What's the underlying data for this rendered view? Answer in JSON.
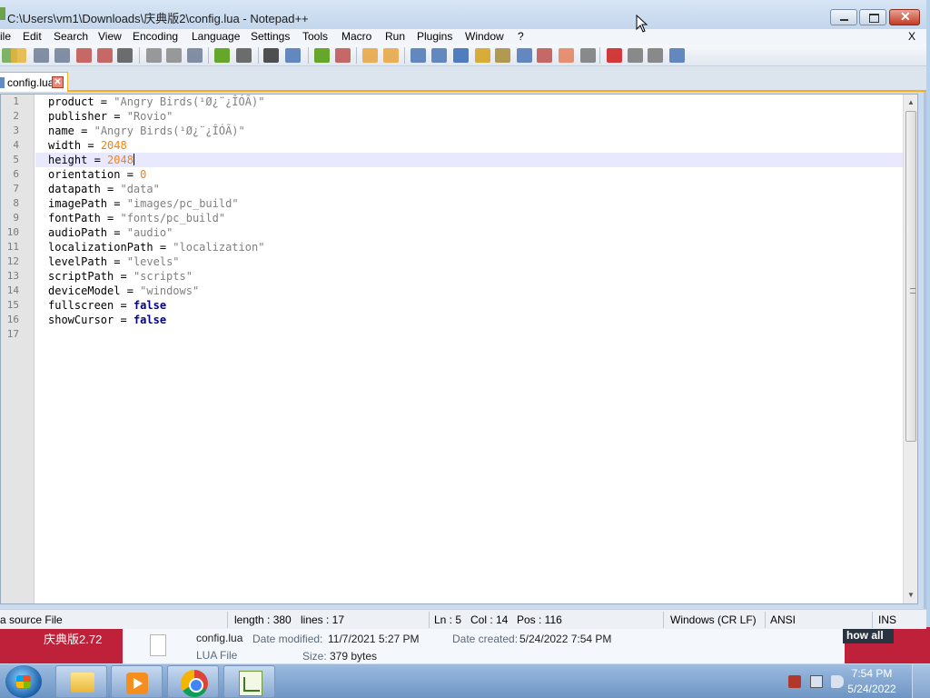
{
  "window": {
    "title": "C:\\Users\\vm1\\Downloads\\庆典版2\\config.lua - Notepad++"
  },
  "menu": {
    "items": [
      "ile",
      "Edit",
      "Search",
      "View",
      "Encoding",
      "Language",
      "Settings",
      "Tools",
      "Macro",
      "Run",
      "Plugins",
      "Window",
      "?"
    ],
    "close": "X"
  },
  "toolbar": {
    "icons": [
      "new-file-icon",
      "open-file-icon",
      "save-icon",
      "save-all-icon",
      "close-icon",
      "close-all-icon",
      "print-icon",
      "cut-icon",
      "copy-icon",
      "paste-icon",
      "undo-icon",
      "redo-icon",
      "find-icon",
      "replace-icon",
      "zoom-in-icon",
      "zoom-out-icon",
      "sync-vertical-icon",
      "sync-horizontal-icon",
      "word-wrap-icon",
      "show-all-chars-icon",
      "indent-guide-icon",
      "user-language-icon",
      "doc-map-icon",
      "function-list-icon",
      "folder-as-workspace-icon",
      "monitoring-icon",
      "record-macro-icon",
      "stop-record-icon",
      "play-macro-icon",
      "run-macro-multiple-icon",
      "save-macro-icon"
    ]
  },
  "tab": {
    "label": "config.lua",
    "close": "✕"
  },
  "editor": {
    "line_numbers": [
      "1",
      "2",
      "3",
      "4",
      "5",
      "6",
      "7",
      "8",
      "9",
      "10",
      "11",
      "12",
      "13",
      "14",
      "15",
      "16",
      "17"
    ],
    "lines": [
      {
        "key": "product",
        "eq": " = ",
        "value": "\"Angry Birds(¹Ø¿¨¿ÎÓÃ)\"",
        "kind": "str"
      },
      {
        "key": "publisher",
        "eq": " = ",
        "value": "\"Rovio\"",
        "kind": "str"
      },
      {
        "key": "name",
        "eq": " = ",
        "value": "\"Angry Birds(¹Ø¿¨¿ÎÓÃ)\"",
        "kind": "str"
      },
      {
        "key": "width",
        "eq": " = ",
        "value": "2048",
        "kind": "num"
      },
      {
        "key": "height",
        "eq": " = ",
        "value": "2048",
        "kind": "num"
      },
      {
        "key": "orientation",
        "eq": " = ",
        "value": "0",
        "kind": "num"
      },
      {
        "key": "datapath",
        "eq": " = ",
        "value": "\"data\"",
        "kind": "str"
      },
      {
        "key": "imagePath",
        "eq": " = ",
        "value": "\"images/pc_build\"",
        "kind": "str"
      },
      {
        "key": "fontPath",
        "eq": " = ",
        "value": "\"fonts/pc_build\"",
        "kind": "str"
      },
      {
        "key": "audioPath",
        "eq": " = ",
        "value": "\"audio\"",
        "kind": "str"
      },
      {
        "key": "localizationPath",
        "eq": " = ",
        "value": "\"localization\"",
        "kind": "str"
      },
      {
        "key": "levelPath",
        "eq": " = ",
        "value": "\"levels\"",
        "kind": "str"
      },
      {
        "key": "scriptPath",
        "eq": " = ",
        "value": "\"scripts\"",
        "kind": "str"
      },
      {
        "key": "deviceModel",
        "eq": " = ",
        "value": "\"windows\"",
        "kind": "str"
      },
      {
        "key": "fullscreen",
        "eq": " = ",
        "value": "false",
        "kind": "bool"
      },
      {
        "key": "showCursor",
        "eq": " = ",
        "value": "false",
        "kind": "bool"
      }
    ],
    "current_line": 5
  },
  "status": {
    "file_type": "a source File",
    "length": "length : 380",
    "lines": "lines : 17",
    "ln": "Ln : 5",
    "col": "Col : 14",
    "pos": "Pos : 116",
    "eol": "Windows (CR LF)",
    "encoding": "ANSI",
    "mode": "INS"
  },
  "explorer": {
    "left_text": "庆典版2.72",
    "show_all": "how all",
    "file_name": "config.lua",
    "file_type": "LUA File",
    "modified_label": "Date modified:",
    "modified_value": "11/7/2021 5:27 PM",
    "size_label": "Size:",
    "size_value": "379 bytes",
    "created_label": "Date created:",
    "created_value": "5/24/2022 7:54 PM"
  },
  "taskbar": {
    "time": "7:54 PM",
    "date": "5/24/2022"
  },
  "colors": {
    "string": "#808080",
    "number": "#ff8000",
    "keyword": "#00008b",
    "tab_accent": "#f6ad20",
    "current_line": "#e8e8ff"
  }
}
